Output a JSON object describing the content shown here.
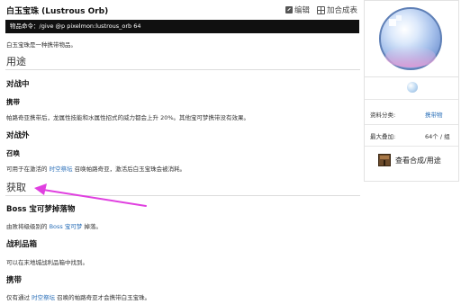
{
  "page": {
    "title": "白玉宝珠 (Lustrous Orb)",
    "edit_label": "编辑",
    "add_table_label": "加合成表",
    "command": "物品命令：/give @p pixelmon:lustrous_orb 64",
    "description": "白玉宝珠是一种携带物品。"
  },
  "sections": {
    "usage": {
      "heading": "用途",
      "battle_in": {
        "heading": "对战中",
        "hold": {
          "heading": "携带",
          "text": "帕路奇亚携带后，龙属性技能和水属性招式的威力都会上升 20%。其他宝可梦携带没有效果。"
        }
      },
      "battle_out": {
        "heading": "对战外",
        "summon": {
          "heading": "召唤",
          "text_before": "可用于在激活的",
          "link": "时空祭坛",
          "text_after": "召唤帕路奇亚，激活后白玉宝珠会被消耗。"
        }
      }
    },
    "obtain": {
      "heading": "获取",
      "boss": {
        "heading": "Boss 宝可梦掉落物",
        "text_before": "由败将级级别的",
        "link": "Boss 宝可梦",
        "text_after": "掉落。"
      },
      "loot": {
        "heading": "战利品箱",
        "text": "可以在末地城战利品箱中找到。"
      },
      "hold": {
        "heading": "携带",
        "text_before": "仅有通过",
        "link": "时空祭坛",
        "text_after": "召唤的帕路奇亚才会携带白玉宝珠。"
      }
    }
  },
  "infobox": {
    "category_label": "资料分类:",
    "category_value": "携带物",
    "stack_label": "最大叠加:",
    "stack_value": "64个 / 组",
    "recipe_button": "查看合成/用途"
  },
  "colors": {
    "link": "#2a6fb8",
    "annotation_arrow": "#e040e0",
    "command_bar": "#101010"
  }
}
